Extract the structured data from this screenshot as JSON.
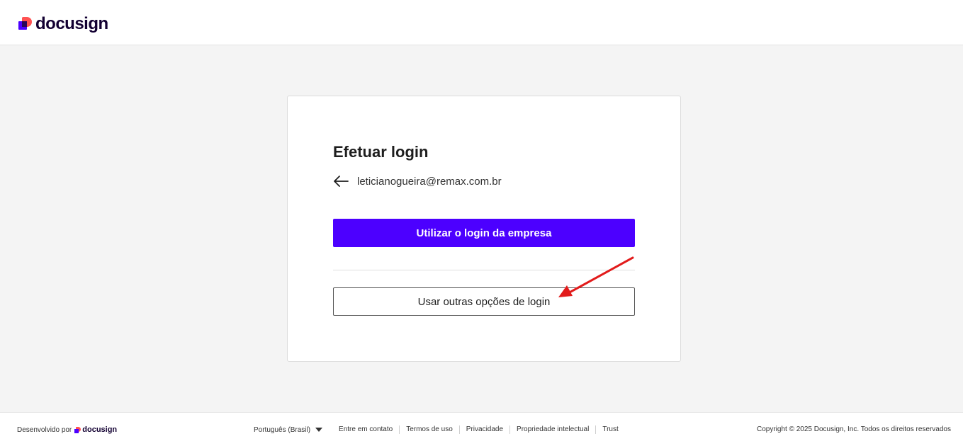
{
  "header": {
    "logo_text": "docusign"
  },
  "login": {
    "title": "Efetuar login",
    "email": "leticianogueira@remax.com.br",
    "primary_button": "Utilizar o login da empresa",
    "secondary_button": "Usar outras opções de login"
  },
  "footer": {
    "powered_by": "Desenvolvido por",
    "logo_text": "docusign",
    "language": "Português (Brasil)",
    "links": [
      "Entre em contato",
      "Termos de uso",
      "Privacidade",
      "Propriedade intelectual",
      "Trust"
    ],
    "copyright": "Copyright © 2025 Docusign, Inc. Todos os direitos reservados"
  },
  "colors": {
    "brand_purple": "#4c00ff",
    "brand_red": "#ff5252",
    "annotation_arrow": "#e21b1b"
  },
  "icons": [
    "docusign-logo-icon",
    "back-arrow-icon",
    "caret-down-icon"
  ]
}
